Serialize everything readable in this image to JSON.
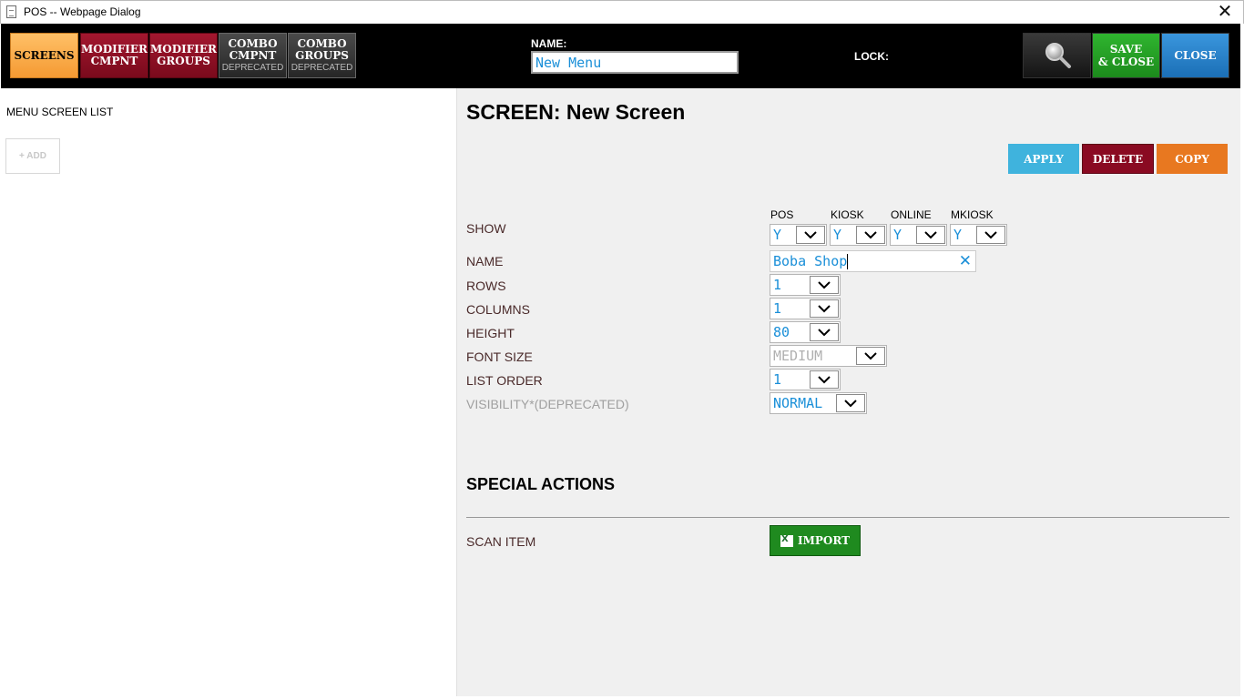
{
  "window": {
    "title": "POS -- Webpage Dialog",
    "close_glyph": "✕"
  },
  "toolbar": {
    "tabs": [
      {
        "line1": "SCREENS",
        "line2": "",
        "sub": ""
      },
      {
        "line1": "MODIFIER",
        "line2": "CMPNT",
        "sub": ""
      },
      {
        "line1": "MODIFIER",
        "line2": "GROUPS",
        "sub": ""
      },
      {
        "line1": "COMBO",
        "line2": "CMPNT",
        "sub": "DEPRECATED"
      },
      {
        "line1": "COMBO",
        "line2": "GROUPS",
        "sub": "DEPRECATED"
      }
    ],
    "name_label": "NAME:",
    "name_value": "New Menu",
    "lock_label": "LOCK:",
    "save_line1": "SAVE",
    "save_line2": "& CLOSE",
    "close_label": "CLOSE"
  },
  "left": {
    "title": "MENU SCREEN LIST",
    "add_label": "+ ADD"
  },
  "screen": {
    "title": "SCREEN: New Screen",
    "apply": "APPLY",
    "delete": "DELETE",
    "copy": "COPY",
    "show_label": "SHOW",
    "show_columns": [
      {
        "head": "POS",
        "value": "Y"
      },
      {
        "head": "KIOSK",
        "value": "Y"
      },
      {
        "head": "ONLINE",
        "value": "Y"
      },
      {
        "head": "MKIOSK",
        "value": "Y"
      }
    ],
    "name_label": "NAME",
    "name_value": "Boba Shop",
    "rows_label": "ROWS",
    "rows_value": "1",
    "columns_label": "COLUMNS",
    "columns_value": "1",
    "height_label": "HEIGHT",
    "height_value": "80",
    "font_size_label": "FONT SIZE",
    "font_size_value": "MEDIUM",
    "list_order_label": "LIST ORDER",
    "list_order_value": "1",
    "visibility_label": "VISIBILITY*(DEPRECATED)",
    "visibility_value": "NORMAL"
  },
  "special": {
    "title": "SPECIAL ACTIONS",
    "scan_label": "SCAN ITEM",
    "import_label": "IMPORT"
  },
  "icons": {
    "search": "magnifier-icon",
    "excel": "excel-icon",
    "dropdown": "chevron-down-icon",
    "document": "document-icon"
  },
  "colors": {
    "screens_tab": "#f59a32",
    "modifier_tab": "#8a0a22",
    "combo_tab": "#333333",
    "save": "#1c8a1c",
    "close": "#1b6fb6",
    "apply": "#3fb3dd",
    "delete": "#8a0a22",
    "copy": "#e87820",
    "import": "#1f8a1f",
    "value_text": "#1a8fd8"
  }
}
